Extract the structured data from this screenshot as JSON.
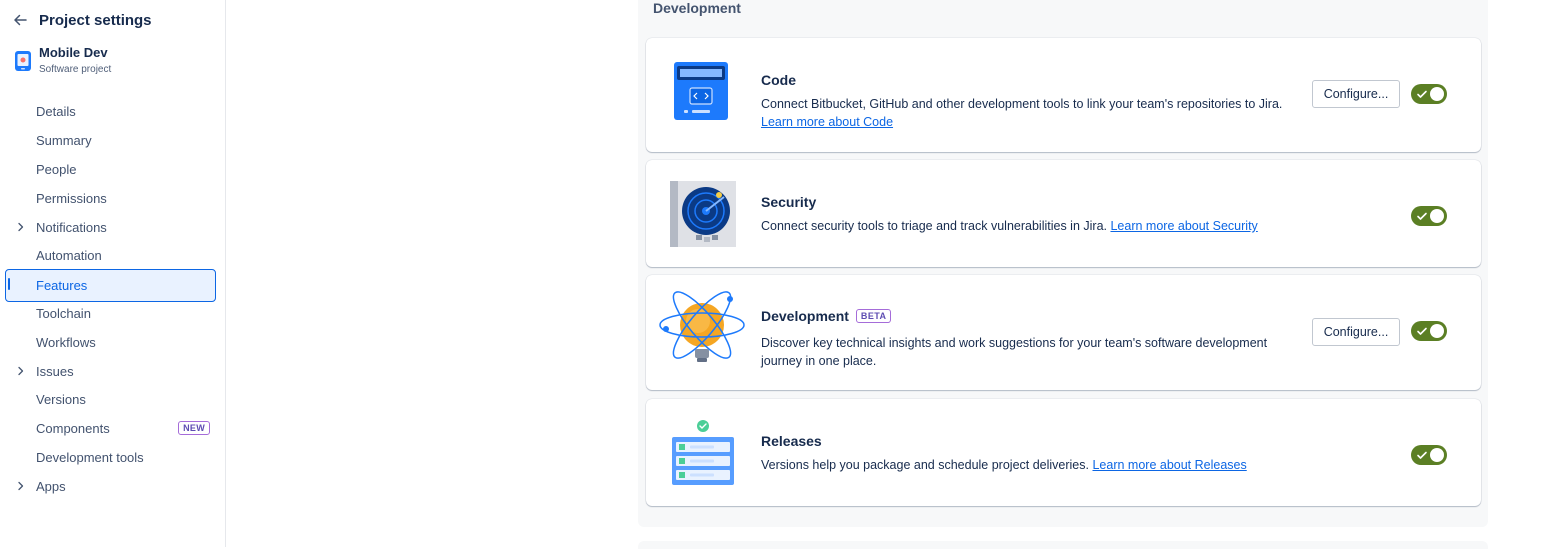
{
  "sidebar": {
    "back_title": "Project settings",
    "project_name": "Mobile Dev",
    "project_type": "Software project",
    "items": [
      {
        "label": "Details"
      },
      {
        "label": "Summary"
      },
      {
        "label": "People"
      },
      {
        "label": "Permissions"
      },
      {
        "label": "Notifications"
      },
      {
        "label": "Automation"
      },
      {
        "label": "Features"
      },
      {
        "label": "Toolchain"
      },
      {
        "label": "Workflows"
      },
      {
        "label": "Issues"
      },
      {
        "label": "Versions"
      },
      {
        "label": "Components",
        "badge": "NEW"
      },
      {
        "label": "Development tools"
      },
      {
        "label": "Apps"
      }
    ]
  },
  "main": {
    "section_title": "Development",
    "cards": [
      {
        "title": "Code",
        "description": "Connect Bitbucket, GitHub and other development tools to link your team's repositories to Jira.",
        "link": "Learn more about Code",
        "button": "Configure...",
        "enabled": true
      },
      {
        "title": "Security",
        "description": "Connect security tools to triage and track vulnerabilities in Jira.",
        "link": "Learn more about Security",
        "enabled": true
      },
      {
        "title": "Development",
        "badge": "BETA",
        "description": "Discover key technical insights and work suggestions for your team's software development journey in one place.",
        "button": "Configure...",
        "enabled": true
      },
      {
        "title": "Releases",
        "description": "Versions help you package and schedule project deliveries.",
        "link": "Learn more about Releases",
        "enabled": true
      }
    ]
  },
  "colors": {
    "toggle_on": "#5b7f24",
    "link": "#0c66e4",
    "active_nav_bg": "#e9f2ff",
    "badge_purple": "#5e4db2"
  },
  "icons": {
    "back": "arrow-left-icon",
    "expand": "chevron-right-icon",
    "toggle_check": "check-icon"
  }
}
